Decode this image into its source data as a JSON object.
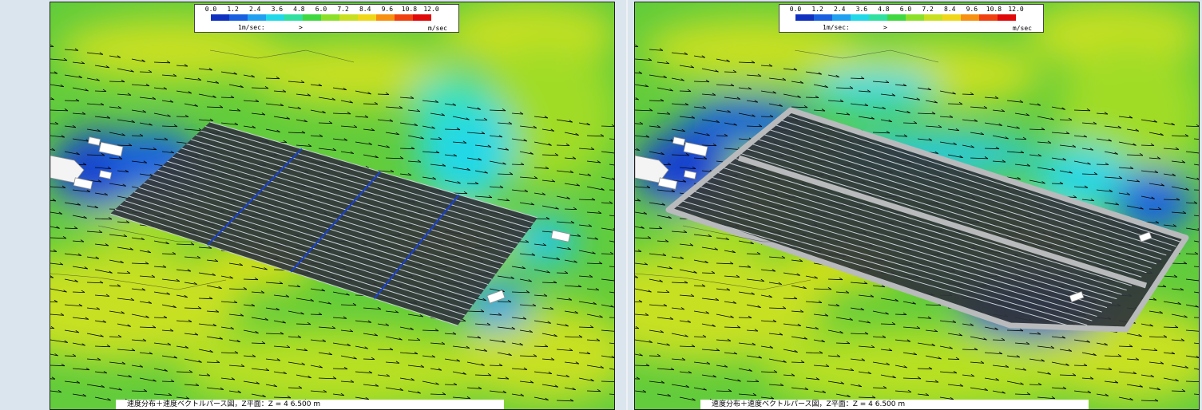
{
  "legend": {
    "ticks": [
      "0.0",
      "1.2",
      "2.4",
      "3.6",
      "4.8",
      "6.0",
      "7.2",
      "8.4",
      "9.6",
      "10.8",
      "12.0"
    ],
    "colors": [
      "#1030c0",
      "#1860e0",
      "#20a0f0",
      "#20d8e8",
      "#30e0a0",
      "#40d840",
      "#8ce028",
      "#c8e020",
      "#f0d818",
      "#f89010",
      "#f04010",
      "#e00808"
    ],
    "unit_left": "1m/sec:",
    "unit_arrow": ">",
    "unit_right": "m/sec"
  },
  "panels": [
    {
      "caption": "速度分布＋速度ベクトルパース図，Z平面：Z = 4    6.500  m",
      "walled": false
    },
    {
      "caption": "速度分布＋速度ベクトルパース図，Z平面：Z = 4    6.500  m",
      "walled": true
    }
  ]
}
